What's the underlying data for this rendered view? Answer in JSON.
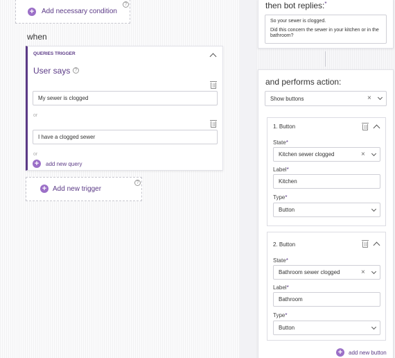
{
  "left": {
    "add_condition_label": "Add necessary condition",
    "when_label": "when",
    "trigger_card": {
      "type_label": "QUERIES TRIGGER",
      "title": "User says",
      "queries": [
        "My sewer is clogged",
        "I have a clogged sewer"
      ],
      "or_label": "or",
      "add_query_label": "add new query"
    },
    "add_trigger_label": "Add new trigger"
  },
  "right": {
    "bot_replies_label": "then bot replies:",
    "reply_lines": [
      "So your sewer is clogged.",
      "Did this concern the sewer in your kitchen or in the bathroom?"
    ],
    "performs_action_label": "and performs action:",
    "action_select": "Show buttons",
    "buttons": [
      {
        "header": "1. Button",
        "state_label": "State",
        "state_value": "Kitchen sewer clogged",
        "label_label": "Label",
        "label_value": "Kitchen",
        "type_label": "Type",
        "type_value": "Button"
      },
      {
        "header": "2. Button",
        "state_label": "State",
        "state_value": "Bathroom sewer clogged",
        "label_label": "Label",
        "label_value": "Bathroom",
        "type_label": "Type",
        "type_value": "Button"
      }
    ],
    "required_mark": "*",
    "add_button_label": "add new button"
  },
  "colors": {
    "accent": "#9b6fc7",
    "accent_dark": "#5b3a86",
    "divider": "#c8c8d0"
  }
}
